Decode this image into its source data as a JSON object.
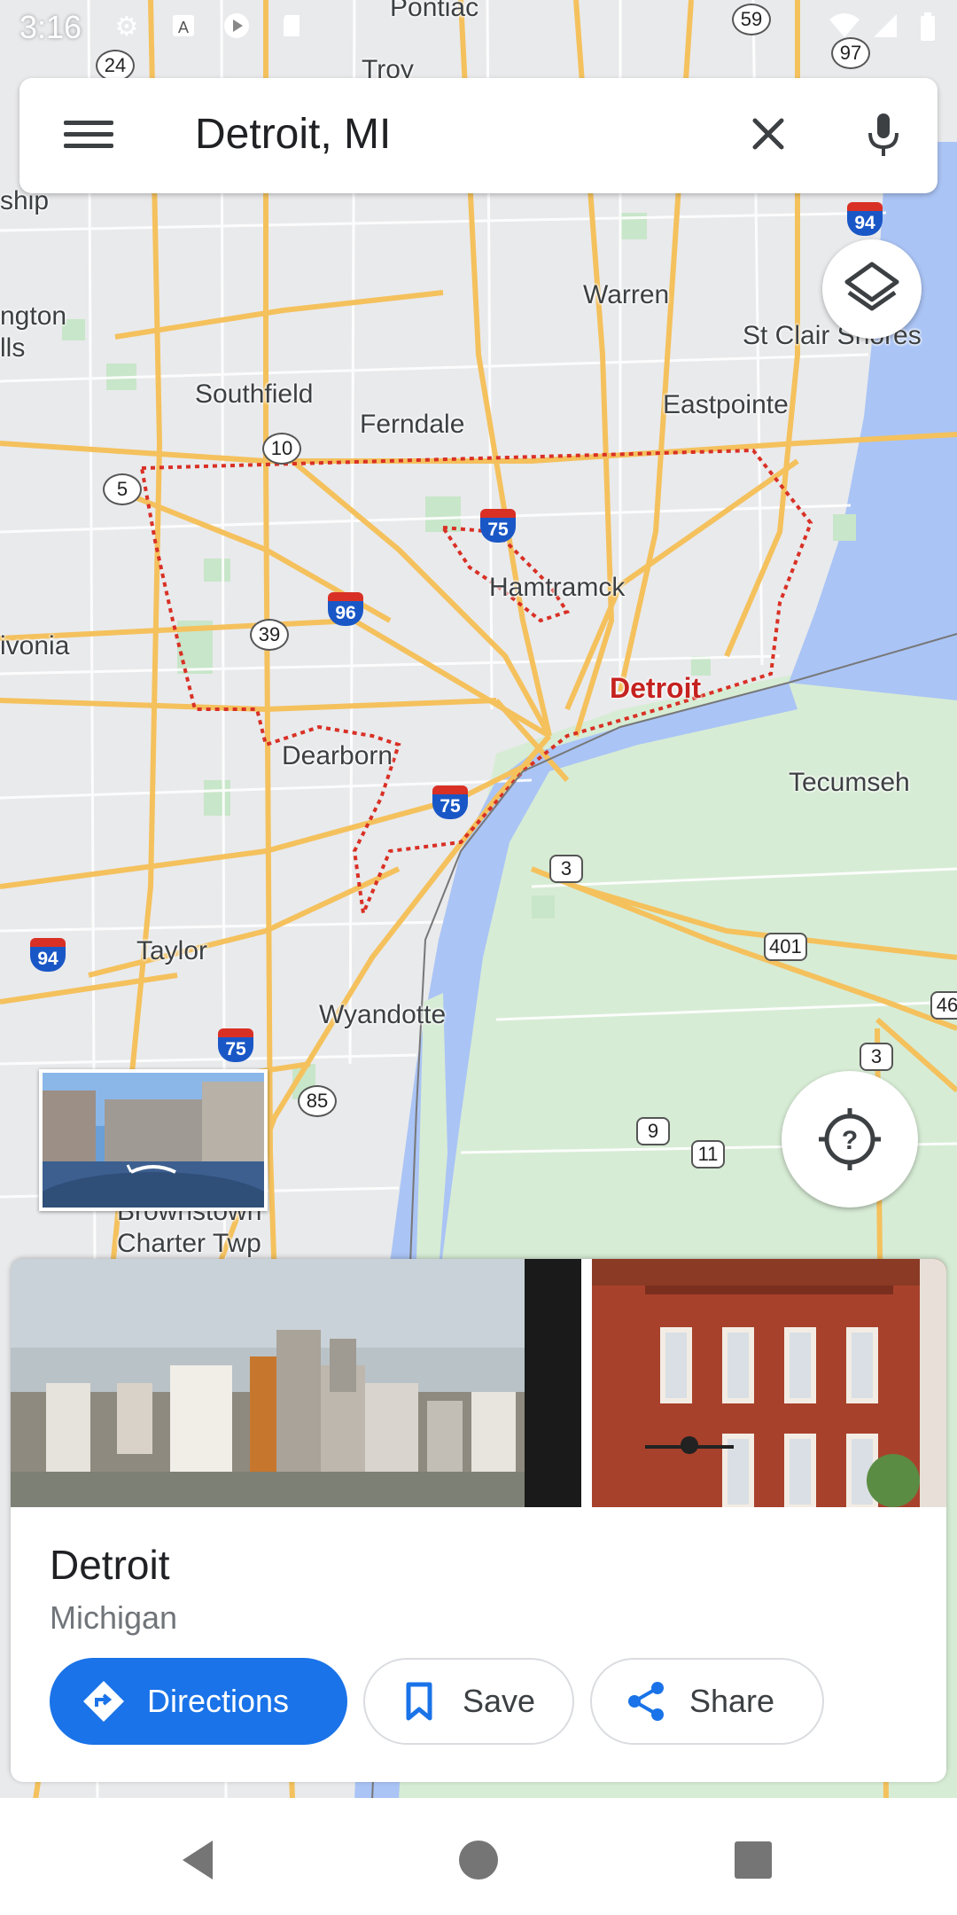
{
  "status_bar": {
    "time": "3:16"
  },
  "search": {
    "query": "Detroit, MI"
  },
  "map": {
    "labels": {
      "troy": "Troy",
      "warren": "Warren",
      "st_clair": "St Clair Shores",
      "southfield": "Southfield",
      "eastpointe": "Eastpointe",
      "ferndale": "Ferndale",
      "hamtramck": "Hamtramck",
      "detroit": "Detroit",
      "livonia": "ivonia",
      "dearborn": "Dearborn",
      "tecumseh": "Tecumseh",
      "taylor": "Taylor",
      "wyandotte": "Wyandotte",
      "brownstown": "Brownstown",
      "charter_twp": "Charter Twp",
      "ington": "ngton",
      "ills": "lls",
      "ship": "ship",
      "pontiac": "Pontiac"
    },
    "shields": {
      "s24": "24",
      "s59": "59",
      "s97": "97",
      "s10": "10",
      "s5": "5",
      "s39": "39",
      "s3a": "3",
      "s401": "401",
      "s3b": "3",
      "s85": "85",
      "s9": "9",
      "s11": "11",
      "s46": "46"
    },
    "interstates": {
      "i94a": "94",
      "i75a": "75",
      "i96": "96",
      "i75b": "75",
      "i94b": "94",
      "i75c": "75"
    }
  },
  "place": {
    "name": "Detroit",
    "region": "Michigan",
    "directions_label": "Directions",
    "save_label": "Save",
    "share_label": "Share"
  },
  "colors": {
    "accent": "#1a73e8",
    "boundary": "#d93025",
    "water": "#aac4f5",
    "park": "#c8e6c9"
  }
}
